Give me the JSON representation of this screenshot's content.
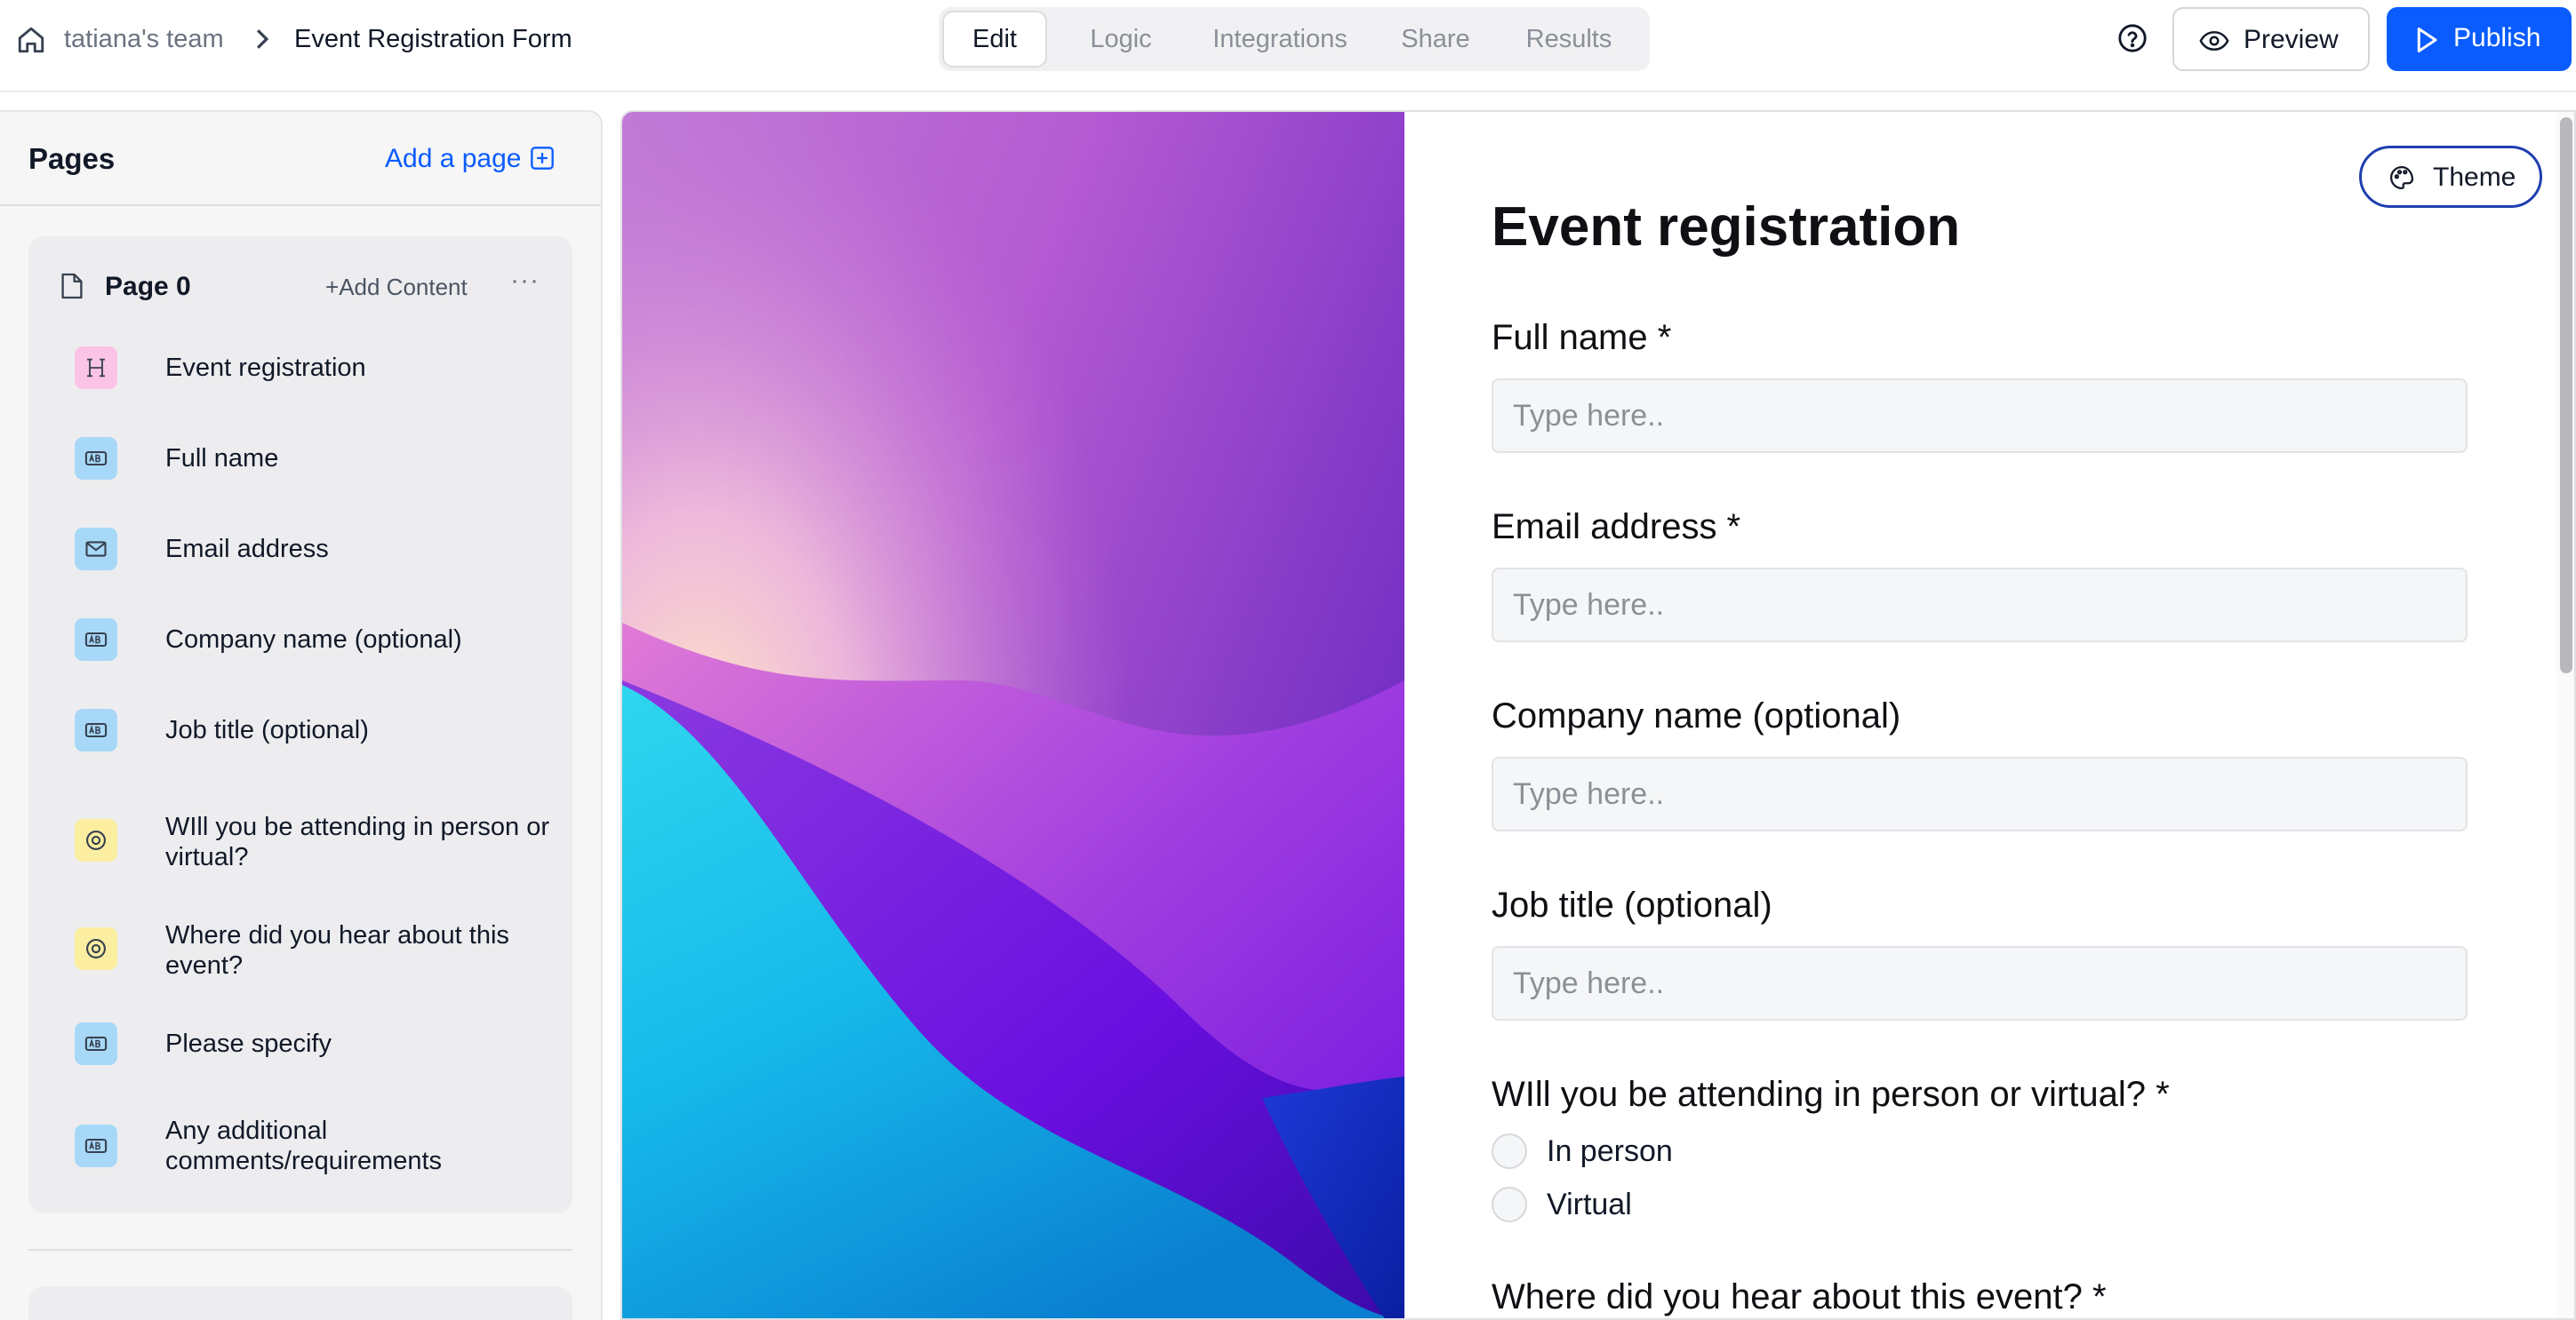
{
  "breadcrumb": {
    "team": "tatiana's team",
    "form_name": "Event Registration Form"
  },
  "tabs": [
    {
      "label": "Edit",
      "active": true
    },
    {
      "label": "Logic",
      "active": false
    },
    {
      "label": "Integrations",
      "active": false
    },
    {
      "label": "Share",
      "active": false
    },
    {
      "label": "Results",
      "active": false
    }
  ],
  "toolbar": {
    "help_icon": "question-circle-icon",
    "preview_label": "Preview",
    "publish_label": "Publish"
  },
  "colors": {
    "accent": "#0a5cff",
    "theme_border": "#1f3fb0",
    "badge_heading": "#fbc4e6",
    "badge_text": "#a8d8f8",
    "badge_choice": "#fbeea0"
  },
  "sidebar": {
    "title": "Pages",
    "add_page_label": "Add a page",
    "page": {
      "name": "Page 0",
      "add_content_label": "Add Content",
      "items": [
        {
          "label": "Event registration",
          "icon": "heading-icon"
        },
        {
          "label": "Full name",
          "icon": "short-text-icon"
        },
        {
          "label": "Email address",
          "icon": "email-icon"
        },
        {
          "label": "Company name (optional)",
          "icon": "short-text-icon"
        },
        {
          "label": "Job title (optional)",
          "icon": "short-text-icon"
        },
        {
          "label": "WIll you be attending in person or virtual?",
          "icon": "radio-choice-icon"
        },
        {
          "label": "Where did you hear about this event?",
          "icon": "radio-choice-icon"
        },
        {
          "label": "Please specify",
          "icon": "short-text-icon"
        },
        {
          "label": "Any additional comments/requirements",
          "icon": "short-text-icon"
        }
      ]
    }
  },
  "form": {
    "theme_label": "Theme",
    "title": "Event registration",
    "questions": [
      {
        "label": "Full name *",
        "placeholder": "Type here.."
      },
      {
        "label": "Email address *",
        "placeholder": "Type here.."
      },
      {
        "label": "Company name (optional)",
        "placeholder": "Type here.."
      },
      {
        "label": "Job title (optional)",
        "placeholder": "Type here.."
      }
    ],
    "attendance": {
      "label": "WIll you be attending in person or virtual? *",
      "options": [
        "In person",
        "Virtual"
      ]
    },
    "hear_about": {
      "label": "Where did you hear about this event? *"
    }
  }
}
